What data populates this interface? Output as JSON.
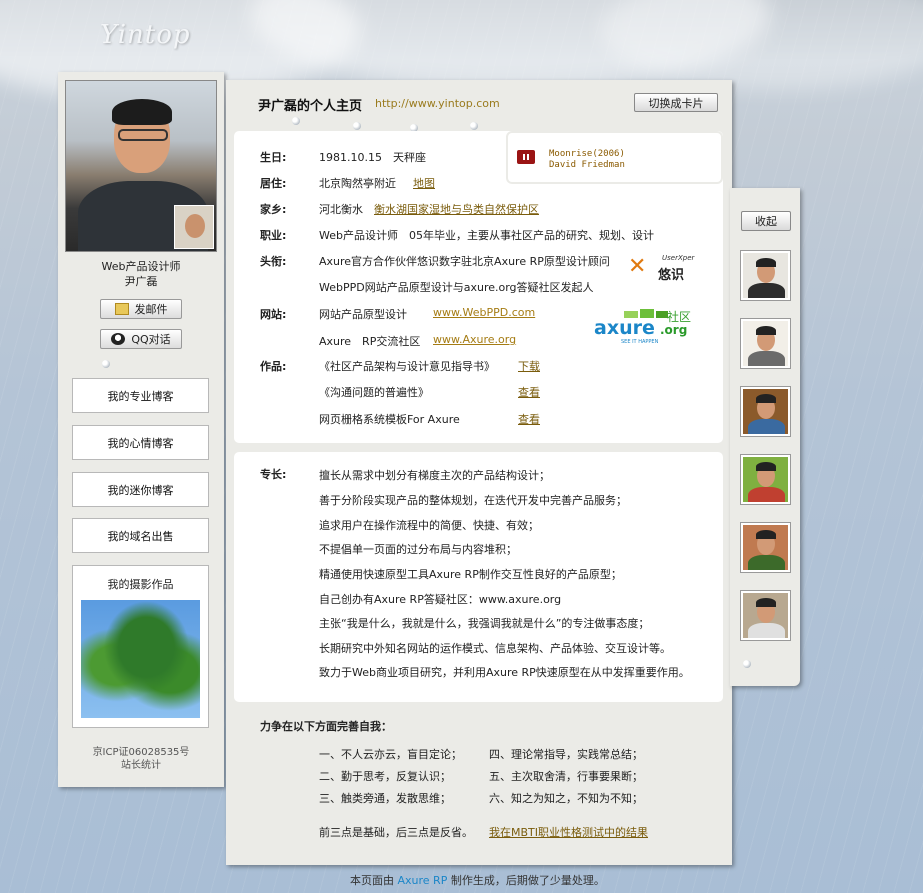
{
  "brand": {
    "logo": "Yintop"
  },
  "header": {
    "title": "尹广磊的个人主页",
    "url": "http://www.yintop.com",
    "switch_label": "切换成卡片"
  },
  "profile": {
    "role": "Web产品设计师",
    "name": "尹广磊",
    "mail_label": "发邮件",
    "qq_label": "QQ对话"
  },
  "sidebar": {
    "items": [
      {
        "label": "我的专业博客"
      },
      {
        "label": "我的心情博客"
      },
      {
        "label": "我的迷你博客"
      },
      {
        "label": "我的域名出售"
      }
    ],
    "photo_title": "我的摄影作品",
    "icp": "京ICP证06028535号",
    "stats": "站长统计"
  },
  "music": {
    "line1": "Moonrise(2006)",
    "line2": "David Friedman"
  },
  "info": {
    "birthday_label": "生日:",
    "birthday": "1981.10.15　天秤座",
    "home_label": "居住:",
    "home": "北京陶然亭附近",
    "home_link": "地图",
    "hometown_label": "家乡:",
    "hometown": "河北衡水",
    "hometown_link": "衡水湖国家湿地与鸟类自然保护区",
    "job_label": "职业:",
    "job": "Web产品设计师　05年毕业，主要从事社区产品的研究、规划、设计",
    "title_label": "头衔:",
    "title1": "Axure官方合作伙伴悠识数字驻北京Axure RP原型设计顾问",
    "title2": "WebPPD网站产品原型设计与axure.org答疑社区发起人",
    "site_label": "网站:",
    "site1": "网站产品原型设计",
    "site1_link": "www.WebPPD.com",
    "site2": "Axure　RP交流社区",
    "site2_link": "www.Axure.org",
    "works_label": "作品:",
    "work1": "《社区产品架构与设计意见指导书》",
    "work1_link": "下载",
    "work2": "《沟通问题的普遍性》",
    "work2_link": "查看",
    "work3": "网页栅格系统模板For Axure",
    "work3_link": "查看"
  },
  "logos": {
    "userxper_small": "UserXper",
    "userxper_cn": "悠识",
    "axure_text": "axure",
    "axure_org": ".org",
    "axure_cn": "社区",
    "axure_tag": "SEE IT HAPPEN"
  },
  "skills": {
    "label": "专长:",
    "items": [
      "擅长从需求中划分有梯度主次的产品结构设计；",
      "善于分阶段实现产品的整体规划，在迭代开发中完善产品服务；",
      "追求用户在操作流程中的简便、快捷、有效；",
      "不提倡单一页面的过分布局与内容堆积；",
      "精通使用快速原型工具Axure RP制作交互性良好的产品原型；",
      "自己创办有Axure RP答疑社区：www.axure.org",
      "主张“我是什么，我就是什么，我强调我就是什么”的专注做事态度；",
      "长期研究中外知名网站的运作模式、信息架构、产品体验、交互设计等。",
      "致力于Web商业项目研究，并利用Axure RP快速原型在从中发挥重要作用。"
    ]
  },
  "improve": {
    "title": "力争在以下方面完善自我：",
    "left": [
      "一、不人云亦云，盲目定论；",
      "二、勤于思考，反复认识；",
      "三、触类旁通，发散思维；"
    ],
    "right": [
      "四、理论常指导，实践常总结；",
      "五、主次取舍清，行事要果断；",
      "六、知之为知之，不知为不知；"
    ],
    "note": "前三点是基础，后三点是反省。",
    "mbti_link": "我在MBTI职业性格测试中的结果"
  },
  "right_panel": {
    "collapse_label": "收起"
  },
  "footer": {
    "prefix": "本页面由",
    "tool": "Axure RP",
    "suffix": "制作生成，后期做了少量处理。"
  },
  "colors": {
    "link": "#7a5c0c",
    "accent_blue": "#1b86c8",
    "panel": "#ebebe7",
    "music_red": "#9a1414"
  }
}
